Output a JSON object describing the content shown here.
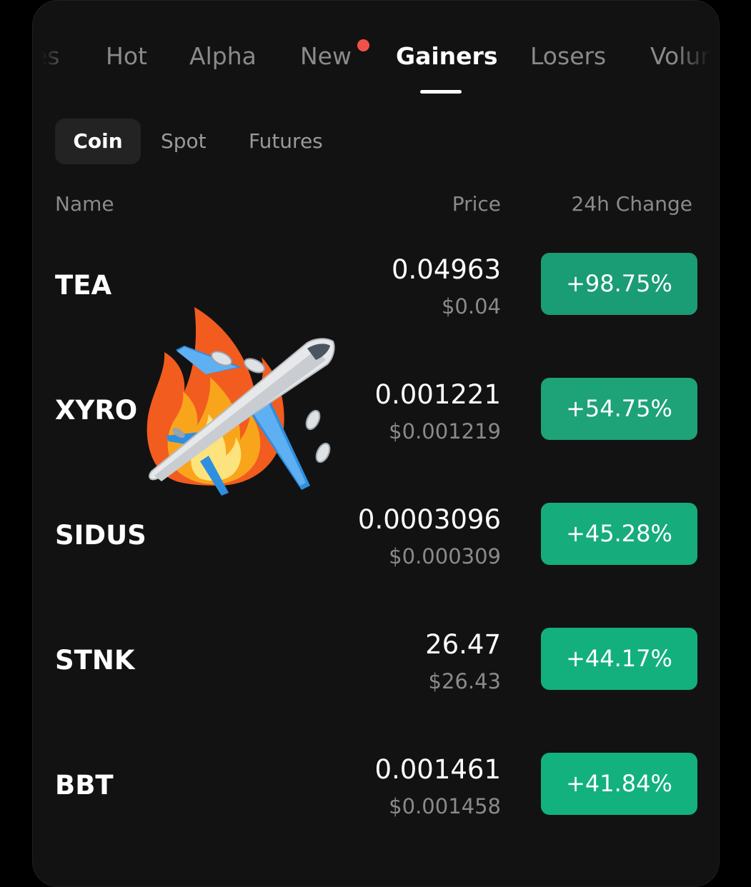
{
  "tabs": [
    {
      "label": "es"
    },
    {
      "label": "Hot"
    },
    {
      "label": "Alpha"
    },
    {
      "label": "New"
    },
    {
      "label": "Gainers"
    },
    {
      "label": "Losers"
    },
    {
      "label": "Volun"
    }
  ],
  "active_tab": "Gainers",
  "subtabs": [
    {
      "label": "Coin"
    },
    {
      "label": "Spot"
    },
    {
      "label": "Futures"
    }
  ],
  "columns": {
    "name": "Name",
    "price": "Price",
    "change": "24h Change"
  },
  "rows": [
    {
      "symbol": "TEA",
      "price": "0.04963",
      "usd": "$0.04",
      "change": "+98.75%",
      "color": "#1a9c74"
    },
    {
      "symbol": "XYRO",
      "price": "0.001221",
      "usd": "$0.001219",
      "change": "+54.75%",
      "color": "#1ea278"
    },
    {
      "symbol": "SIDUS",
      "price": "0.0003096",
      "usd": "$0.000309",
      "change": "+45.28%",
      "color": "#17ac7b"
    },
    {
      "symbol": "STNK",
      "price": "26.47",
      "usd": "$26.43",
      "change": "+44.17%",
      "color": "#13b07e"
    },
    {
      "symbol": "BBT",
      "price": "0.001461",
      "usd": "$0.001458",
      "change": "+41.84%",
      "color": "#12b17e"
    }
  ],
  "colors": {
    "background": "#121212",
    "accent_green": "#1aae7c",
    "notification_dot": "#f0524b"
  },
  "overlay": {
    "icons": [
      "fire-icon",
      "airplane-icon"
    ]
  }
}
